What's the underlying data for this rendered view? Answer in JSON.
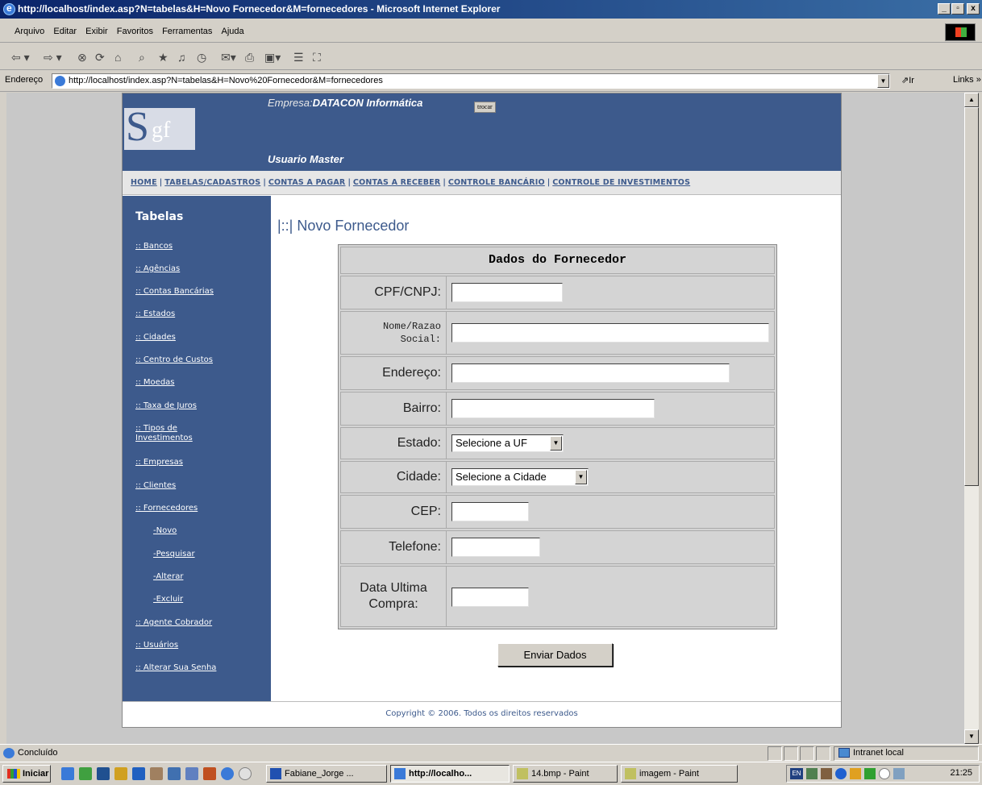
{
  "window": {
    "title": "http://localhost/index.asp?N=tabelas&H=Novo Fornecedor&M=fornecedores - Microsoft Internet Explorer",
    "minimize": "_",
    "maximize": "▫",
    "close": "x"
  },
  "menu": [
    "Arquivo",
    "Editar",
    "Exibir",
    "Favoritos",
    "Ferramentas",
    "Ajuda"
  ],
  "address": {
    "label": "Endereço",
    "url": "http://localhost/index.asp?N=tabelas&H=Novo%20Fornecedor&M=fornecedores",
    "go": "Ir",
    "links": "Links »"
  },
  "header": {
    "logo_s": "S",
    "logo_gf": "gf",
    "empresa_label": "Empresa:",
    "empresa_name": "DATACON Informática",
    "trocar": "trocar",
    "usuario": "Usuario Master"
  },
  "nav": [
    "HOME",
    "TABELAS/CADASTROS",
    "CONTAS A PAGAR",
    "CONTAS A RECEBER",
    "CONTROLE BANCÁRIO",
    "CONTROLE DE INVESTIMENTOS"
  ],
  "sidebar": {
    "title": "Tabelas",
    "items": [
      {
        "label": ":: Bancos"
      },
      {
        "label": ":: Agências"
      },
      {
        "label": ":: Contas Bancárias"
      },
      {
        "label": ":: Estados"
      },
      {
        "label": ":: Cidades"
      },
      {
        "label": ":: Centro de Custos"
      },
      {
        "label": ":: Moedas"
      },
      {
        "label": ":: Taxa de Juros"
      },
      {
        "label": ":: Tipos de Investimentos"
      },
      {
        "label": ":: Empresas"
      },
      {
        "label": ":: Clientes"
      },
      {
        "label": ":: Fornecedores"
      },
      {
        "label": "-Novo"
      },
      {
        "label": "-Pesquisar"
      },
      {
        "label": "-Alterar"
      },
      {
        "label": "-Excluir"
      },
      {
        "label": ":: Agente Cobrador"
      },
      {
        "label": ":: Usuários"
      },
      {
        "label": ":: Alterar Sua Senha"
      }
    ]
  },
  "content": {
    "page_title": "|::| Novo Fornecedor",
    "form_title": "Dados do Fornecedor",
    "fields": {
      "cpf": "CPF/CNPJ:",
      "nome": "Nome/Razao Social:",
      "endereco": "Endereço:",
      "bairro": "Bairro:",
      "estado": "Estado:",
      "cidade": "Cidade:",
      "cep": "CEP:",
      "telefone": "Telefone:",
      "data": "Data Ultima Compra:"
    },
    "estado_select": "Selecione a UF",
    "cidade_select": "Selecione a Cidade",
    "submit": "Enviar Dados"
  },
  "footer": "Copyright © 2006. Todos os direitos reservados",
  "status": {
    "text": "Concluído",
    "zone": "Intranet local"
  },
  "taskbar": {
    "start": "Iniciar",
    "tasks": [
      "Fabiane_Jorge ...",
      "http://localho...",
      "14.bmp - Paint",
      "imagem - Paint"
    ],
    "tray_lang": "EN",
    "clock": "21:25"
  }
}
